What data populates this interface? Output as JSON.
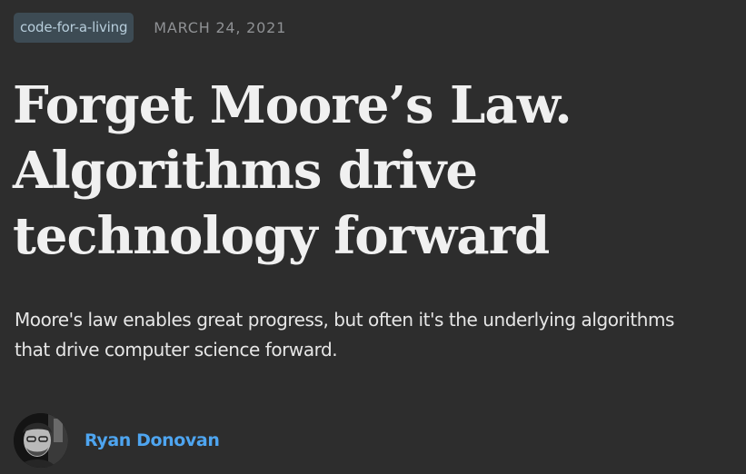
{
  "post": {
    "tag": "code-for-a-living",
    "date": "MARCH 24, 2021",
    "title_lines": [
      "Forget Moore’s Law.",
      "Algorithms drive",
      "technology forward"
    ],
    "subtitle_lines": [
      "Moore's law enables great progress, but often it's the underlying algorithms",
      "that drive computer science forward."
    ]
  },
  "author": {
    "name": "Ryan Donovan",
    "avatar_icon": "author-avatar-photo"
  },
  "colors": {
    "background": "#2d2d2d",
    "tag_background": "#3d4b54",
    "tag_text": "#b7cddb",
    "date_text": "#8f9194",
    "title_text": "#f0f0f0",
    "author_link": "#4ea5f0"
  }
}
